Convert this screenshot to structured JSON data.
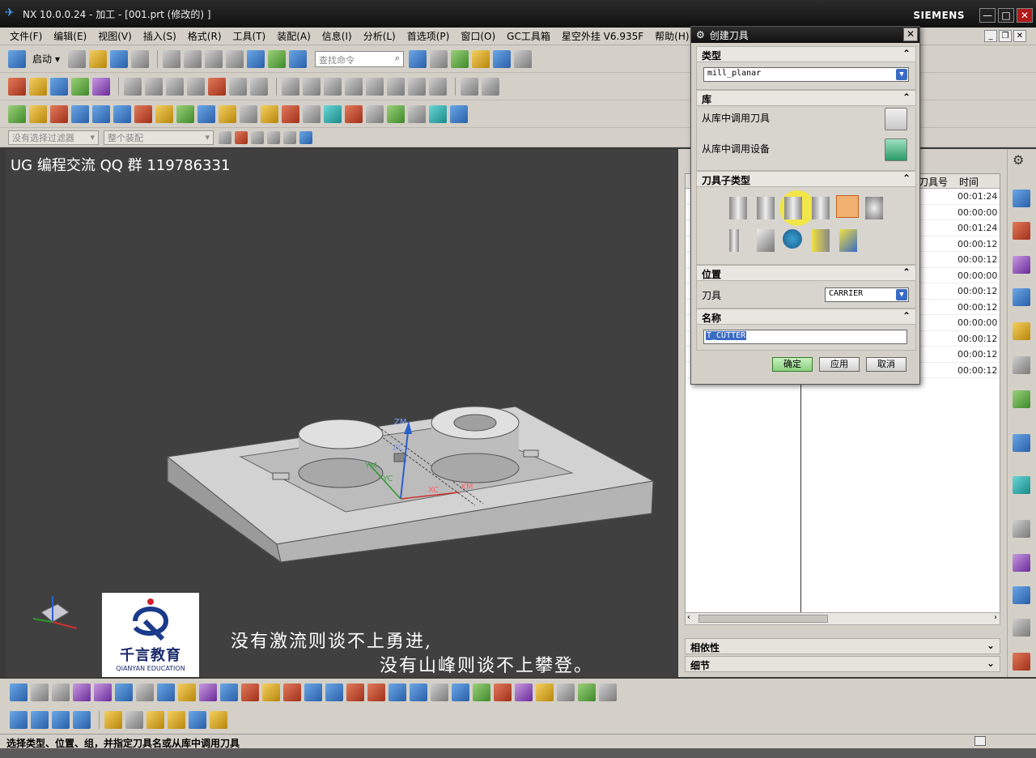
{
  "window": {
    "title": "NX 10.0.0.24 - 加工 - [001.prt  (修改的) ]",
    "brand": "SIEMENS",
    "controls": [
      "—",
      "□",
      "✕"
    ]
  },
  "menu": {
    "items": [
      "文件(F)",
      "编辑(E)",
      "视图(V)",
      "插入(S)",
      "格式(R)",
      "工具(T)",
      "装配(A)",
      "信息(I)",
      "分析(L)",
      "首选项(P)",
      "窗口(O)",
      "GC工具箱",
      "星空外挂 V6.935F",
      "帮助(H)"
    ]
  },
  "toolbar": {
    "start_label": "启动",
    "search_placeholder": "查找命令",
    "filter_select": "没有选择过滤器",
    "assembly_select": "整个装配"
  },
  "viewport": {
    "watermark": "UG 编程交流 QQ 群 119786331",
    "logo_cn": "千言教育",
    "logo_en": "QIANYAN EDUCATION",
    "quote_line1": "没有激流则谈不上勇进,",
    "quote_line2": "没有山峰则谈不上攀登。",
    "axis_labels": {
      "zm": "ZM",
      "zc": "ZC",
      "ym": "YM",
      "yc": "YC",
      "xc": "XC",
      "xm": "XM"
    }
  },
  "navigator": {
    "col_tool": "刀具号",
    "col_time": "时间",
    "times": [
      "00:01:24",
      "00:00:00",
      "00:01:24",
      "00:00:12",
      "00:00:12",
      "00:00:00",
      "00:00:12",
      "00:00:12",
      "00:00:00",
      "00:00:12",
      "00:00:12",
      "00:00:12"
    ],
    "section_dependency": "相依性",
    "section_details": "细节"
  },
  "dialog": {
    "title": "创建刀具",
    "type_header": "类型",
    "type_value": "mill_planar",
    "library_header": "库",
    "library_tool_label": "从库中调用刀具",
    "library_device_label": "从库中调用设备",
    "subtype_header": "刀具子类型",
    "location_header": "位置",
    "location_tool_label": "刀具",
    "location_tool_value": "CARRIER",
    "name_header": "名称",
    "name_value": "T_CUTTER",
    "ok_label": "确定",
    "apply_label": "应用",
    "cancel_label": "取消"
  },
  "status": {
    "prompt": "选择类型、位置、组，并指定刀具名或从库中调用刀具"
  }
}
